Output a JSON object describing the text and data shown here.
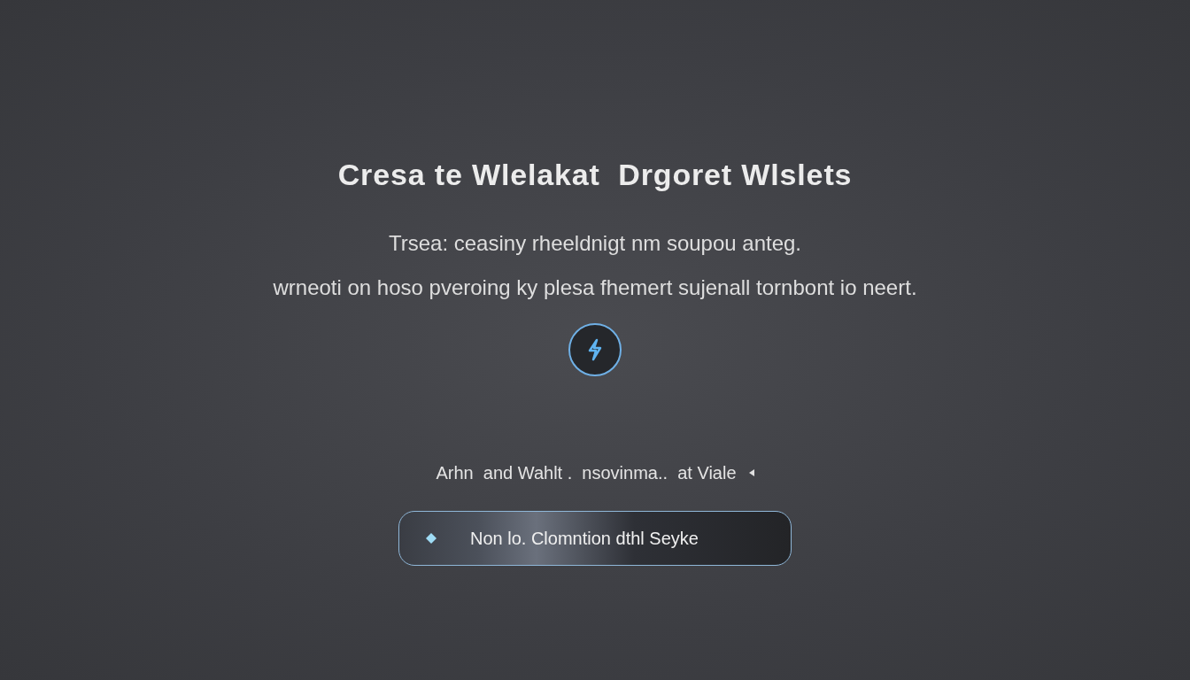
{
  "title": "Cresa te Wlelakat  Drgoret Wlslets",
  "description": [
    "Trsea: ceasiny rheeldnigt nm soupou anteg.",
    "wrneoti on hoso pveroing ky plesa fhemert sujenall tornbont io neert."
  ],
  "hint": "Arhn  and Wahlt .  nsovinma..  at Viale",
  "action_button": {
    "label": "Non lo. Clomntion dthl Seyke"
  }
}
